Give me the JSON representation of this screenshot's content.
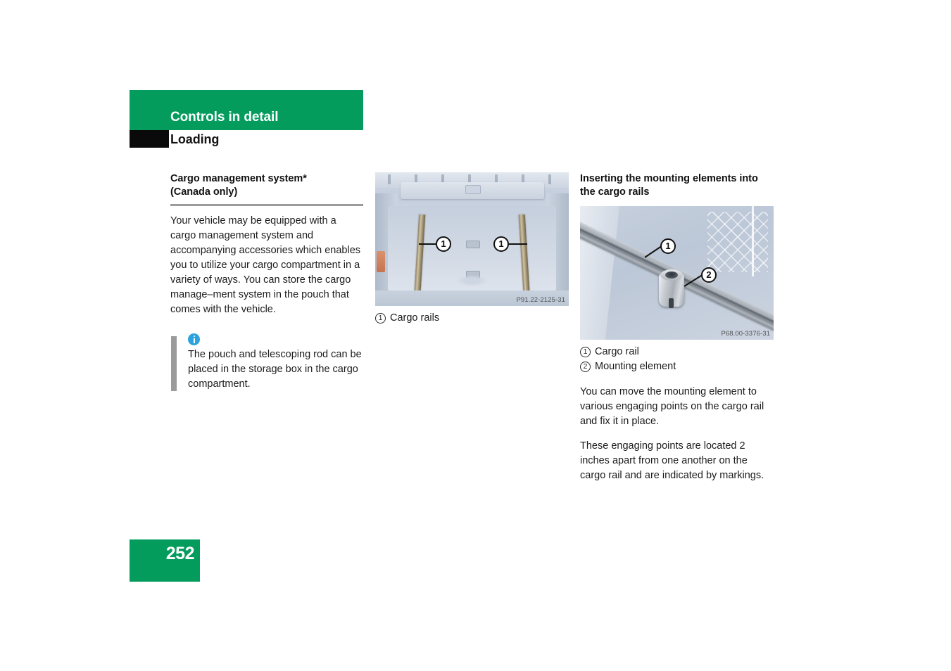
{
  "header": {
    "chapter": "Controls in detail",
    "section": "Loading"
  },
  "left_column": {
    "heading_line1": "Cargo management system*",
    "heading_line2": "(Canada only)",
    "paragraph": "Your vehicle may be equipped with a cargo management system and accompanying accessories which enables you to utilize your cargo compartment in a variety of ways. You can store the cargo manage–ment system in the pouch that comes with the vehicle.",
    "note": {
      "icon": "info-icon",
      "text": "The pouch and telescoping rod can be placed in the storage box in the cargo compartment."
    }
  },
  "middle_column": {
    "figure": {
      "alt": "Cargo compartment of station wagon showing two cargo rails on the load floor",
      "image_code": "P91.22-2125-31",
      "callouts": [
        "1",
        "1"
      ]
    },
    "legend": [
      {
        "num": "1",
        "label": "Cargo rails"
      }
    ]
  },
  "right_column": {
    "heading_line1": "Inserting the mounting elements into",
    "heading_line2": "the cargo rails",
    "figure": {
      "alt": "Close-up of a cargo rail with a cylindrical mounting element installed",
      "image_code": "P68.00-3376-31",
      "callouts": [
        "1",
        "2"
      ]
    },
    "legend": [
      {
        "num": "1",
        "label": "Cargo rail"
      },
      {
        "num": "2",
        "label": "Mounting element"
      }
    ],
    "paragraph1": "You can move the mounting element to various engaging points on the cargo rail and fix it in place.",
    "paragraph2": "These engaging points are located 2 inches apart from one another on the cargo rail and are indicated by markings."
  },
  "footer": {
    "page_number": "252"
  },
  "colors": {
    "brand_green": "#039c5d",
    "tab_black": "#0a0a0a",
    "rule_gray": "#9b9b9b",
    "info_blue": "#2ba4dd"
  }
}
